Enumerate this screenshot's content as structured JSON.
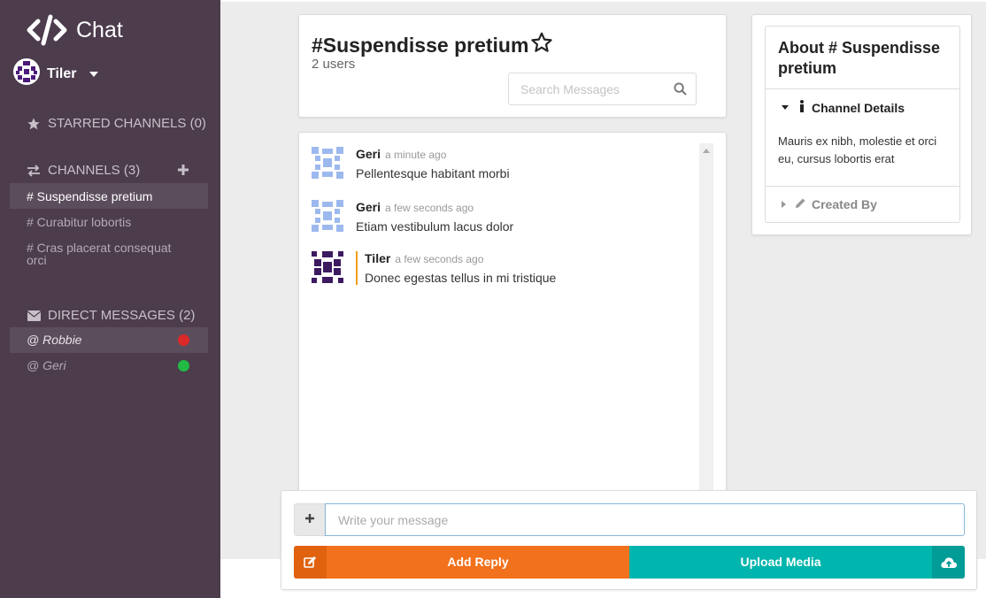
{
  "app": {
    "name": "Chat"
  },
  "user": {
    "name": "Tiler"
  },
  "sidebar": {
    "starred": {
      "label": "STARRED CHANNELS (0)"
    },
    "channels": {
      "label": "CHANNELS (3)",
      "items": [
        {
          "label": "# Suspendisse pretium",
          "active": true
        },
        {
          "label": "# Curabitur lobortis",
          "active": false
        },
        {
          "label": "# Cras placerat consequat orci",
          "active": false
        }
      ]
    },
    "direct_messages": {
      "label": "DIRECT MESSAGES (2)",
      "items": [
        {
          "label": "@ Robbie",
          "status": "offline",
          "status_color": "#db2828"
        },
        {
          "label": "@ Geri",
          "status": "online",
          "status_color": "#21ba45"
        }
      ]
    }
  },
  "header": {
    "title": "#Suspendisse pretium",
    "users": "2 users",
    "search_placeholder": "Search Messages"
  },
  "messages": [
    {
      "author": "Geri",
      "time": "a minute ago",
      "text": "Pellentesque habitant morbi",
      "avatar": "blue-identicon"
    },
    {
      "author": "Geri",
      "time": "a few seconds ago",
      "text": "Etiam vestibulum lacus dolor",
      "avatar": "blue-identicon"
    },
    {
      "author": "Tiler",
      "time": "a few seconds ago",
      "text": "Donec egestas tellus in mi tristique",
      "avatar": "purple-identicon",
      "own": true
    }
  ],
  "about": {
    "title": "About # Suspendisse pretium",
    "details_label": "Channel Details",
    "description": "Mauris ex nibh, molestie et orci eu, cursus lobortis erat",
    "created_by_label": "Created By"
  },
  "composer": {
    "placeholder": "Write your message",
    "reply_label": "Add Reply",
    "upload_label": "Upload Media"
  },
  "colors": {
    "sidebar_bg": "#4c3c4c",
    "reply": "#f2711c",
    "upload": "#00b5ad",
    "own_message_accent": "#f39c12"
  }
}
